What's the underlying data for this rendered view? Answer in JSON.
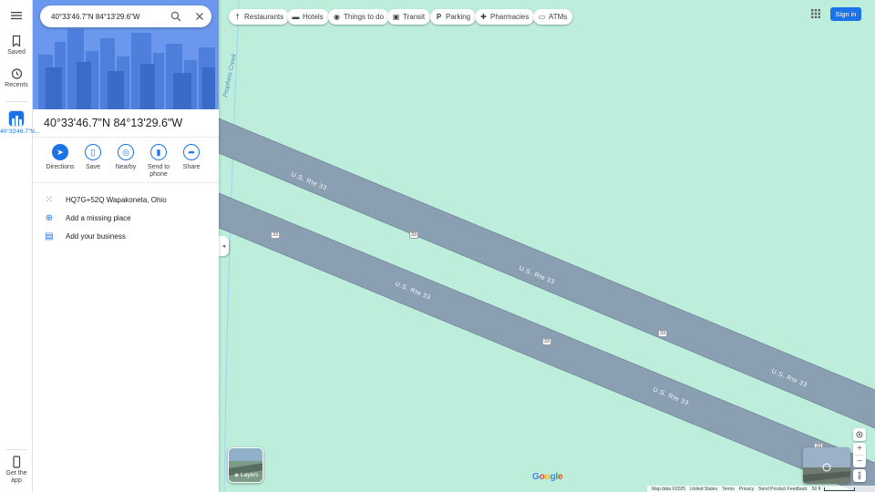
{
  "search": {
    "value": "40°33'46.7\"N 84°13'29.6\"W"
  },
  "rail": {
    "saved_label": "Saved",
    "recents_label": "Recents",
    "recent_place_label": "40°33'46.7\"N...",
    "get_app_label": "Get the app"
  },
  "place": {
    "title": "40°33'46.7\"N 84°13'29.6\"W"
  },
  "actions": [
    {
      "label": "Directions",
      "icon": "directions-icon"
    },
    {
      "label": "Save",
      "icon": "bookmark-icon"
    },
    {
      "label": "Nearby",
      "icon": "nearby-icon"
    },
    {
      "label": "Send to phone",
      "icon": "phone-icon"
    },
    {
      "label": "Share",
      "icon": "share-icon"
    }
  ],
  "info_rows": [
    {
      "text": "HQ7G+52Q Wapakoneta, Ohio",
      "icon": "plus-code-icon"
    },
    {
      "text": "Add a missing place",
      "icon": "add-place-icon"
    },
    {
      "text": "Add your business",
      "icon": "business-icon"
    }
  ],
  "chips": [
    {
      "label": "Restaurants",
      "icon": "restaurant-icon"
    },
    {
      "label": "Hotels",
      "icon": "hotel-icon"
    },
    {
      "label": "Things to do",
      "icon": "camera-icon"
    },
    {
      "label": "Transit",
      "icon": "transit-icon"
    },
    {
      "label": "Parking",
      "icon": "parking-icon"
    },
    {
      "label": "Pharmacies",
      "icon": "pharmacy-icon"
    },
    {
      "label": "ATMs",
      "icon": "atm-icon"
    }
  ],
  "top_right": {
    "sign_in_label": "Sign in"
  },
  "layers_label": "Layers",
  "map": {
    "water_label": "Prophets Creek",
    "road_labels": [
      "U.S. Rte 33",
      "U.S. Rte 33",
      "U.S. Rte 33",
      "U.S. Rte 33",
      "U.S. Rte 33",
      "U.S. Rte 33"
    ],
    "shields": [
      "33",
      "33",
      "33",
      "33",
      "33"
    ]
  },
  "footer": {
    "map_data": "Map data ©2025",
    "region": "United States",
    "terms": "Terms",
    "privacy": "Privacy",
    "feedback": "Send Product Feedback",
    "scale": "50 ft"
  },
  "colors": {
    "map_bg": "#bdeedc",
    "road": "#8a9fb2",
    "accent": "#1a73e8",
    "pin": "#ea4335"
  }
}
